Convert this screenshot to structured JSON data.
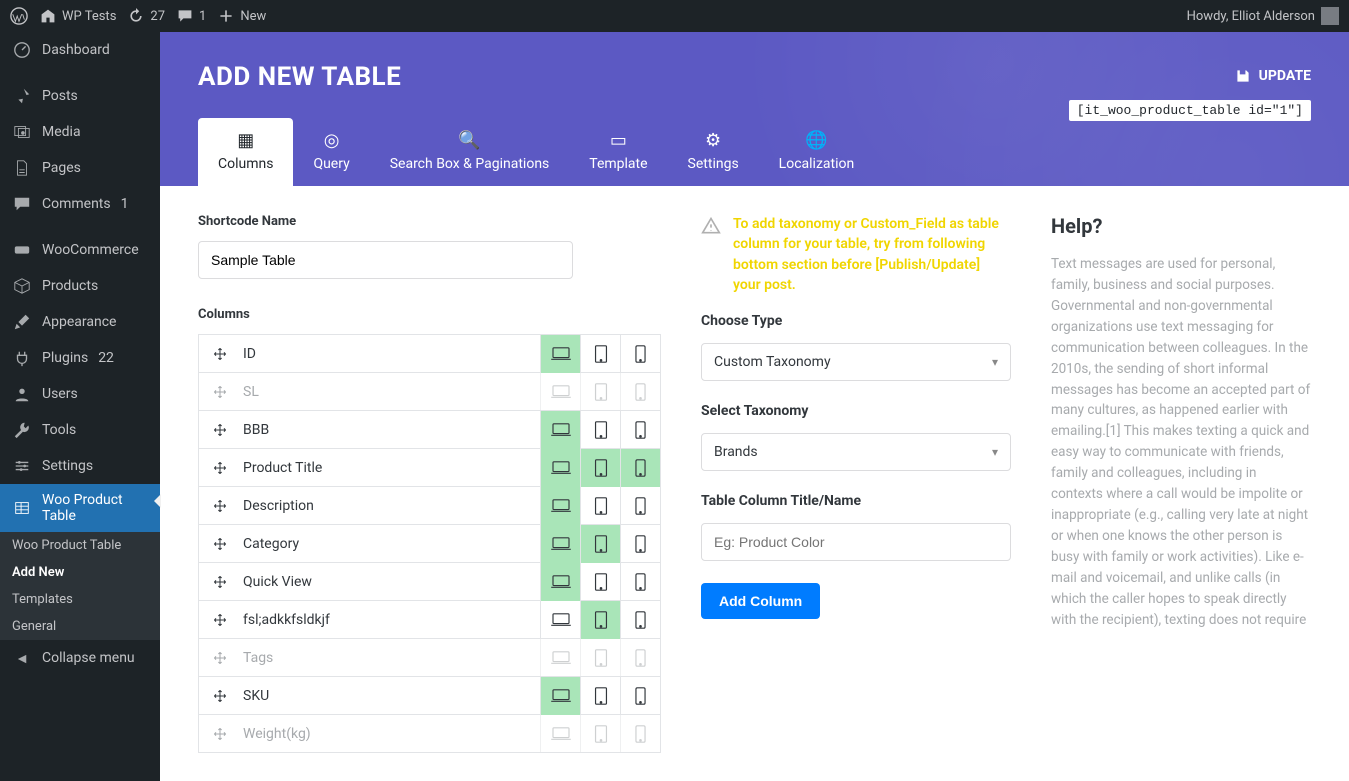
{
  "adminbar": {
    "site_name": "WP Tests",
    "updates": "27",
    "comments": "1",
    "new_label": "New",
    "greeting": "Howdy, Elliot Alderson"
  },
  "sidebar": {
    "items": [
      {
        "label": "Dashboard",
        "icon": "dashboard"
      },
      {
        "label": "Posts",
        "icon": "pin"
      },
      {
        "label": "Media",
        "icon": "media"
      },
      {
        "label": "Pages",
        "icon": "page"
      },
      {
        "label": "Comments",
        "icon": "comment",
        "badge": "1"
      },
      {
        "label": "WooCommerce",
        "icon": "woo"
      },
      {
        "label": "Products",
        "icon": "product"
      },
      {
        "label": "Appearance",
        "icon": "brush"
      },
      {
        "label": "Plugins",
        "icon": "plugin",
        "badge": "22"
      },
      {
        "label": "Users",
        "icon": "user"
      },
      {
        "label": "Tools",
        "icon": "tool"
      },
      {
        "label": "Settings",
        "icon": "settings"
      },
      {
        "label": "Woo Product Table",
        "icon": "woo_table",
        "active": true
      }
    ],
    "submenu": [
      "Woo Product Table",
      "Add New",
      "Templates",
      "General"
    ],
    "submenu_current": 1,
    "collapse": "Collapse menu"
  },
  "hero": {
    "title": "ADD NEW TABLE",
    "update": "UPDATE",
    "shortcode": "[it_woo_product_table id=\"1\"]",
    "tabs": [
      "Columns",
      "Query",
      "Search Box & Paginations",
      "Template",
      "Settings",
      "Localization"
    ]
  },
  "form": {
    "shortcode_name_label": "Shortcode Name",
    "shortcode_name_value": "Sample Table",
    "columns_label": "Columns",
    "columns": [
      {
        "label": "ID",
        "enabled": true,
        "devices": [
          true,
          false,
          false
        ]
      },
      {
        "label": "SL",
        "enabled": false,
        "devices": [
          false,
          false,
          false
        ]
      },
      {
        "label": "BBB",
        "enabled": true,
        "devices": [
          true,
          false,
          false
        ]
      },
      {
        "label": "Product Title",
        "enabled": true,
        "devices": [
          true,
          true,
          true
        ]
      },
      {
        "label": "Description",
        "enabled": true,
        "devices": [
          true,
          false,
          false
        ]
      },
      {
        "label": "Category",
        "enabled": true,
        "devices": [
          true,
          true,
          false
        ]
      },
      {
        "label": "Quick View",
        "enabled": true,
        "devices": [
          true,
          false,
          false
        ]
      },
      {
        "label": "fsl;adkkfsldkjf",
        "enabled": true,
        "devices": [
          false,
          true,
          false
        ]
      },
      {
        "label": "Tags",
        "enabled": false,
        "devices": [
          false,
          false,
          false
        ]
      },
      {
        "label": "SKU",
        "enabled": true,
        "devices": [
          true,
          false,
          false
        ]
      },
      {
        "label": "Weight(kg)",
        "enabled": false,
        "devices": [
          false,
          false,
          false
        ]
      }
    ]
  },
  "right_panel": {
    "warning": "To add taxonomy or Custom_Field as table column for your table, try from following bottom section before [Publish/Update] your post.",
    "choose_type_label": "Choose Type",
    "choose_type_value": "Custom Taxonomy",
    "select_tax_label": "Select Taxonomy",
    "select_tax_value": "Brands",
    "col_title_label": "Table Column Title/Name",
    "col_title_placeholder": "Eg: Product Color",
    "add_btn": "Add Column"
  },
  "help": {
    "title": "Help?",
    "text": "Text messages are used for personal, family, business and social purposes. Governmental and non-governmental organizations use text messaging for communication between colleagues. In the 2010s, the sending of short informal messages has become an accepted part of many cultures, as happened earlier with emailing.[1] This makes texting a quick and easy way to communicate with friends, family and colleagues, including in contexts where a call would be impolite or inappropriate (e.g., calling very late at night or when one knows the other person is busy with family or work activities). Like e-mail and voicemail, and unlike calls (in which the caller hopes to speak directly with the recipient), texting does not require"
  }
}
